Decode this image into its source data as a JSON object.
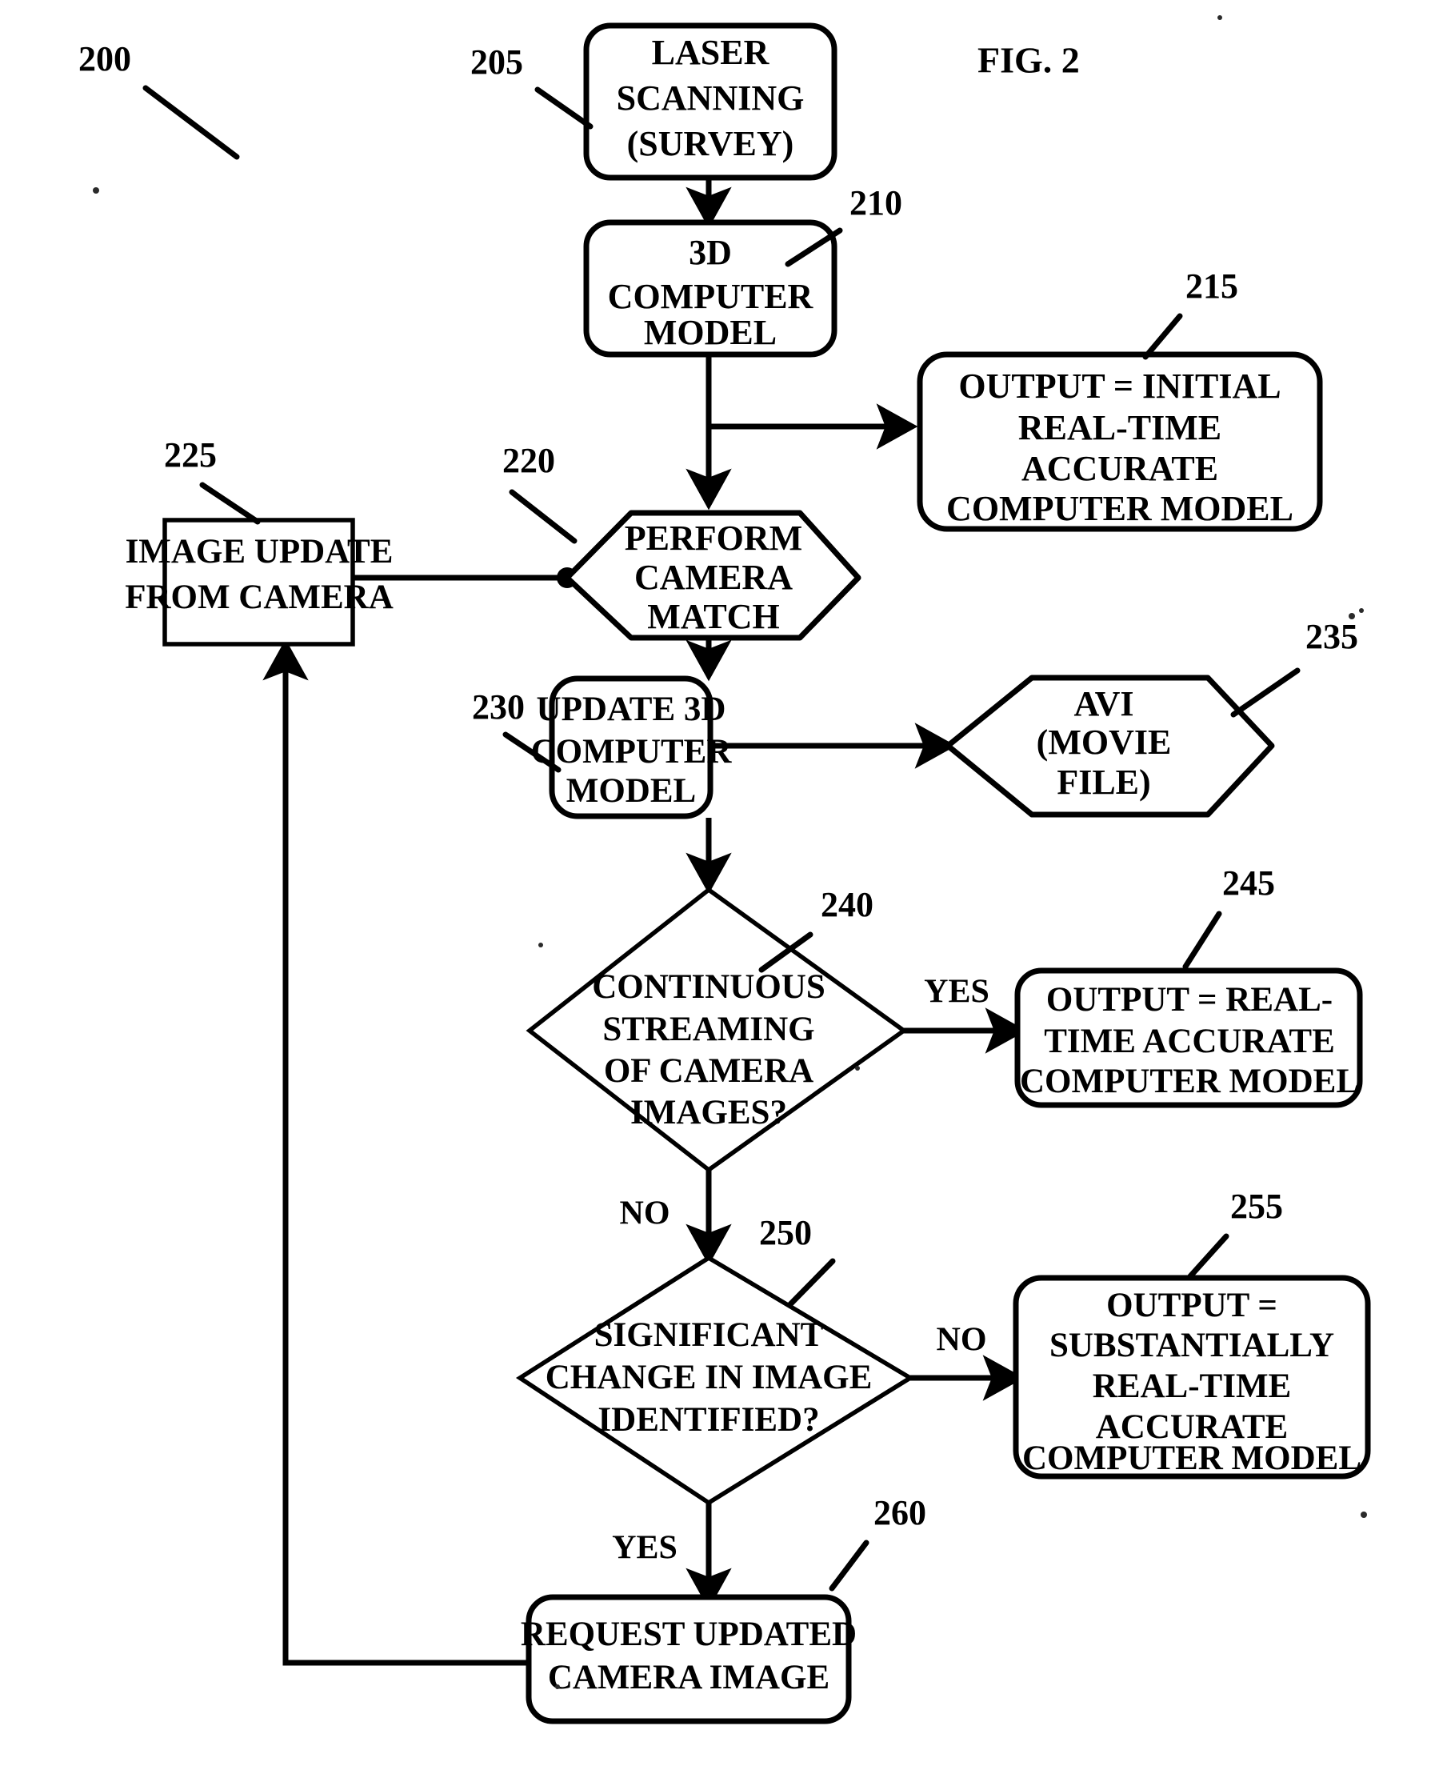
{
  "figure": {
    "label": "FIG. 2",
    "diagram_ref": "200"
  },
  "nodes": [
    {
      "id": "205",
      "ref": "205",
      "shape": "rounded-rect",
      "lines": [
        "LASER",
        "SCANNING",
        "(SURVEY)"
      ]
    },
    {
      "id": "210",
      "ref": "210",
      "shape": "rounded-rect",
      "lines": [
        "3D",
        "COMPUTER",
        "MODEL"
      ]
    },
    {
      "id": "215",
      "ref": "215",
      "shape": "rounded-rect",
      "lines": [
        "OUTPUT = INITIAL",
        "REAL-TIME",
        "ACCURATE",
        "COMPUTER MODEL"
      ]
    },
    {
      "id": "220",
      "ref": "220",
      "shape": "hexagon",
      "lines": [
        "PERFORM",
        "CAMERA",
        "MATCH"
      ]
    },
    {
      "id": "225",
      "ref": "225",
      "shape": "rect",
      "lines": [
        "IMAGE UPDATE",
        "FROM CAMERA"
      ]
    },
    {
      "id": "230",
      "ref": "230",
      "shape": "rounded-rect",
      "lines": [
        "UPDATE 3D",
        "COMPUTER",
        "MODEL"
      ]
    },
    {
      "id": "235",
      "ref": "235",
      "shape": "hexagon",
      "lines": [
        "AVI",
        "(MOVIE",
        "FILE)"
      ]
    },
    {
      "id": "240",
      "ref": "240",
      "shape": "diamond",
      "lines": [
        "CONTINUOUS",
        "STREAMING",
        "OF CAMERA",
        "IMAGES?"
      ]
    },
    {
      "id": "245",
      "ref": "245",
      "shape": "rounded-rect",
      "lines": [
        "OUTPUT = REAL-",
        "TIME ACCURATE",
        "COMPUTER MODEL"
      ]
    },
    {
      "id": "250",
      "ref": "250",
      "shape": "diamond",
      "lines": [
        "SIGNIFICANT",
        "CHANGE IN IMAGE",
        "IDENTIFIED?"
      ]
    },
    {
      "id": "255",
      "ref": "255",
      "shape": "rounded-rect",
      "lines": [
        "OUTPUT =",
        "SUBSTANTIALLY",
        "REAL-TIME",
        "ACCURATE",
        "COMPUTER MODEL"
      ]
    },
    {
      "id": "260",
      "ref": "260",
      "shape": "rounded-rect",
      "lines": [
        "REQUEST UPDATED",
        "CAMERA IMAGE"
      ]
    }
  ],
  "branch_labels": {
    "yes_240": "YES",
    "no_240": "NO",
    "no_250": "NO",
    "yes_250": "YES"
  },
  "text": {
    "n205_l1": "LASER",
    "n205_l2": "SCANNING",
    "n205_l3": "(SURVEY)",
    "n210_l1": "3D",
    "n210_l2": "COMPUTER",
    "n210_l3": "MODEL",
    "n215_l1": "OUTPUT = INITIAL",
    "n215_l2": "REAL-TIME",
    "n215_l3": "ACCURATE",
    "n215_l4": "COMPUTER MODEL",
    "n220_l1": "PERFORM",
    "n220_l2": "CAMERA",
    "n220_l3": "MATCH",
    "n225_l1": "IMAGE UPDATE",
    "n225_l2": "FROM CAMERA",
    "n230_l1": "UPDATE 3D",
    "n230_l2": "COMPUTER",
    "n230_l3": "MODEL",
    "n235_l1": "AVI",
    "n235_l2": "(MOVIE",
    "n235_l3": "FILE)",
    "n240_l1": "CONTINUOUS",
    "n240_l2": "STREAMING",
    "n240_l3": "OF CAMERA",
    "n240_l4": "IMAGES?",
    "n245_l1": "OUTPUT = REAL-",
    "n245_l2": "TIME ACCURATE",
    "n245_l3": "COMPUTER MODEL",
    "n250_l1": "SIGNIFICANT",
    "n250_l2": "CHANGE IN IMAGE",
    "n250_l3": "IDENTIFIED?",
    "n255_l1": "OUTPUT =",
    "n255_l2": "SUBSTANTIALLY",
    "n255_l3": "REAL-TIME",
    "n255_l4": "ACCURATE",
    "n255_l5": "COMPUTER MODEL",
    "n260_l1": "REQUEST UPDATED",
    "n260_l2": "CAMERA IMAGE"
  },
  "refs": {
    "r200": "200",
    "r205": "205",
    "r210": "210",
    "r215": "215",
    "r220": "220",
    "r225": "225",
    "r230": "230",
    "r235": "235",
    "r240": "240",
    "r245": "245",
    "r250": "250",
    "r255": "255",
    "r260": "260"
  }
}
